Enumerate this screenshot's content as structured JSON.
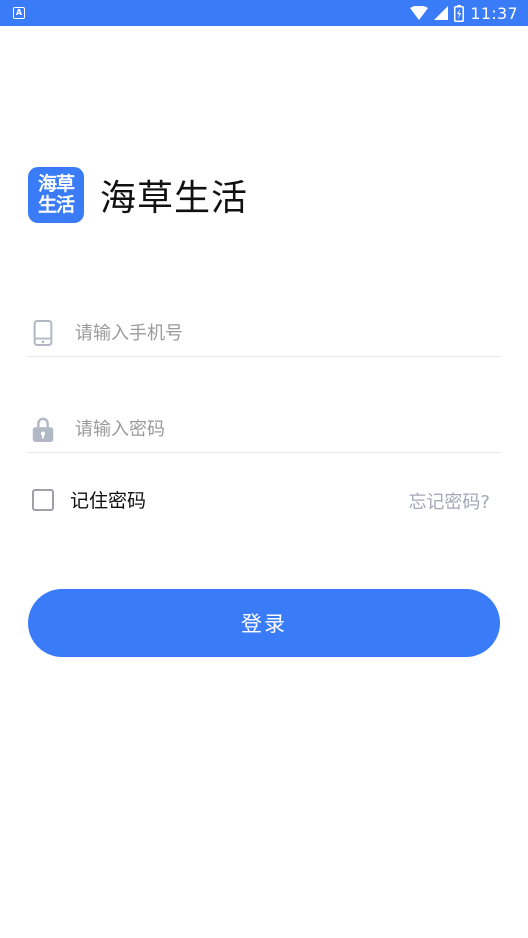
{
  "status_bar": {
    "left_icon": "A",
    "icons": [
      "wifi-icon",
      "cell-signal-icon",
      "battery-charging-icon"
    ],
    "time": "11:37"
  },
  "brand": {
    "logo_text": "海草生活",
    "app_name": "海草生活"
  },
  "form": {
    "phone_placeholder": "请输入手机号",
    "phone_value": "",
    "password_placeholder": "请输入密码",
    "password_value": "",
    "remember_label": "记住密码",
    "remember_checked": false,
    "forgot_label": "忘记密码?"
  },
  "actions": {
    "login_label": "登录"
  },
  "colors": {
    "accent": "#3a7bf7",
    "icon_gray": "#b3b8c6",
    "link_gray": "#a3a8b8"
  }
}
